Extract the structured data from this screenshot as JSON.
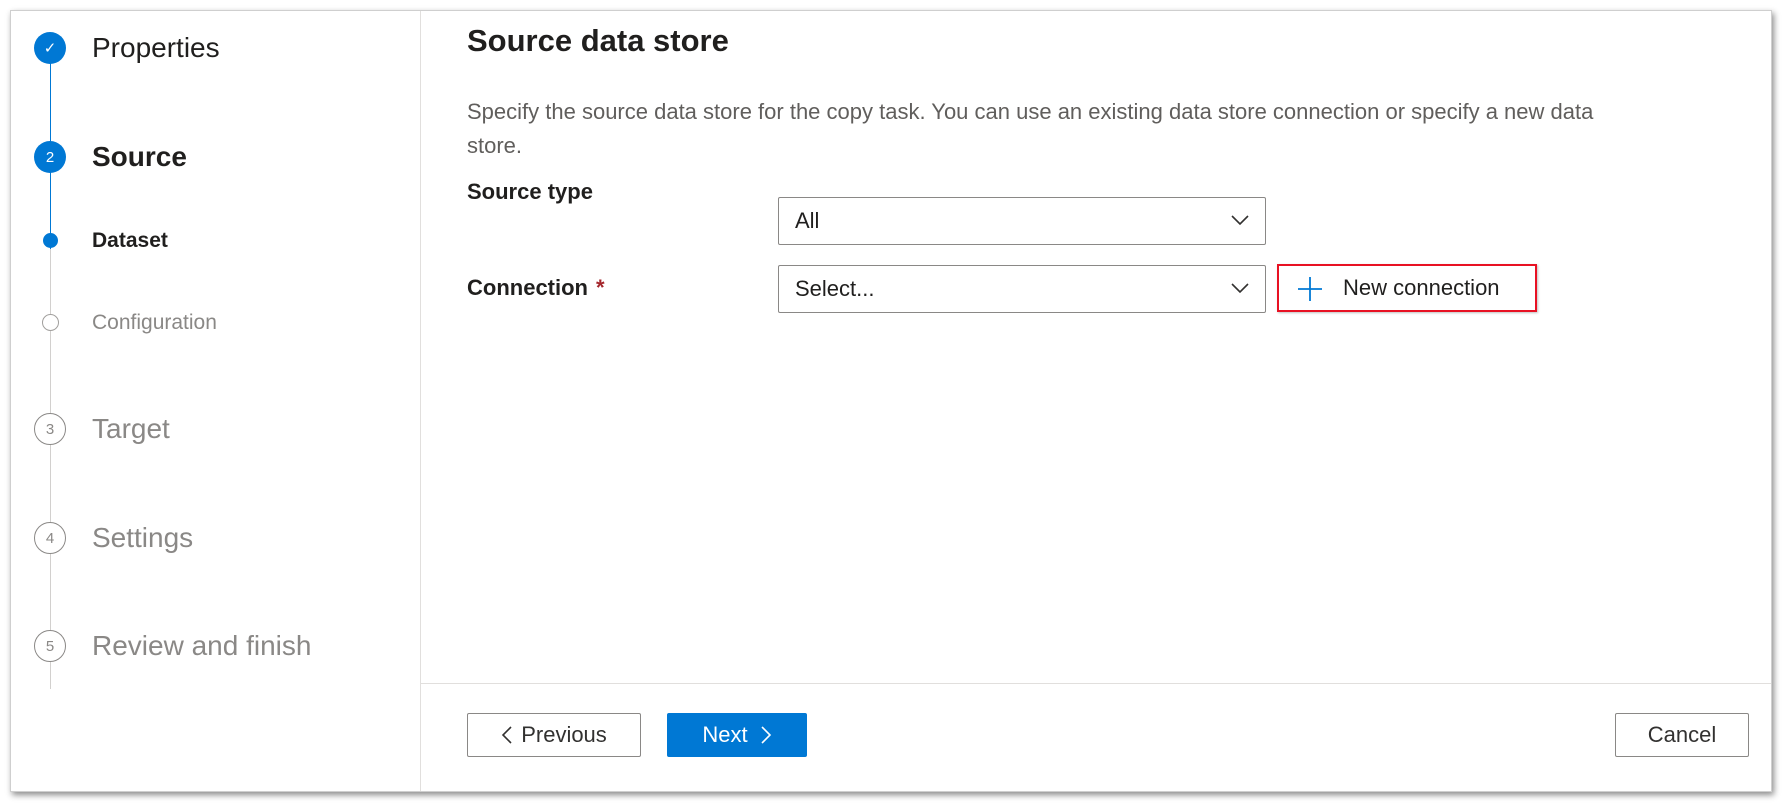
{
  "wizard": {
    "steps": [
      {
        "number": "✓",
        "label": "Properties",
        "state": "completed"
      },
      {
        "number": "2",
        "label": "Source",
        "state": "active"
      },
      {
        "number": "",
        "label": "Dataset",
        "state": "active-substep"
      },
      {
        "number": "",
        "label": "Configuration",
        "state": "pending-substep"
      },
      {
        "number": "3",
        "label": "Target",
        "state": "pending"
      },
      {
        "number": "4",
        "label": "Settings",
        "state": "pending"
      },
      {
        "number": "5",
        "label": "Review and finish",
        "state": "pending"
      }
    ]
  },
  "main": {
    "title": "Source data store",
    "description": "Specify the source data store for the copy task. You can use an existing data store connection or specify a new data store.",
    "source_type": {
      "label": "Source type",
      "value": "All"
    },
    "connection": {
      "label": "Connection",
      "required_marker": "*",
      "value": "Select..."
    },
    "new_connection_label": "New connection"
  },
  "footer": {
    "previous_label": "Previous",
    "next_label": "Next",
    "cancel_label": "Cancel"
  },
  "colors": {
    "accent": "#0078d4",
    "highlight_border": "#e81123",
    "required": "#a4262c",
    "muted_text": "#8a8886"
  }
}
